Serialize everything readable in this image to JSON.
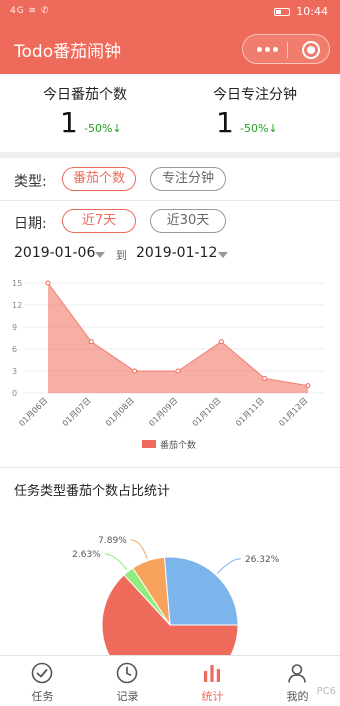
{
  "status": {
    "signal": "4G ≋ ✆",
    "time": "10:44"
  },
  "app": {
    "title": "Todo番茄闹钟",
    "accent": "#ee6b5b"
  },
  "summary": {
    "tomato_label": "今日番茄个数",
    "tomato_value": "1",
    "tomato_change": "-50%↓",
    "focus_label": "今日专注分钟",
    "focus_value": "1",
    "focus_change": "-50%↓"
  },
  "type_filter": {
    "label": "类型:",
    "options": [
      "番茄个数",
      "专注分钟"
    ],
    "selected": "番茄个数"
  },
  "date_filter": {
    "label": "日期:",
    "options": [
      "近7天",
      "近30天"
    ],
    "selected": "近7天"
  },
  "date_range": {
    "start": "2019-01-06",
    "to": "到",
    "end": "2019-01-12"
  },
  "chart_data": {
    "type": "area",
    "categories": [
      "01月06日",
      "01月07日",
      "01月08日",
      "01月09日",
      "01月10日",
      "01月11日",
      "01月12日"
    ],
    "series": [
      {
        "name": "番茄个数",
        "values": [
          15,
          7,
          3,
          3,
          7,
          2,
          1
        ]
      }
    ],
    "yticks": [
      "15",
      "12",
      "9",
      "6",
      "3",
      "0"
    ],
    "ylim": [
      0,
      15
    ],
    "color": "#ee6b5b",
    "legend": "bottom"
  },
  "pie_section": {
    "title": "任务类型番茄个数占比统计",
    "chart_data": {
      "type": "pie",
      "slices": [
        {
          "label": "26.32%",
          "value": 26.32,
          "color": "#7cb5ec"
        },
        {
          "label": "7.89%",
          "value": 7.89,
          "color": "#f7a35c"
        },
        {
          "label": "2.63%",
          "value": 2.63,
          "color": "#90ed7d"
        },
        {
          "label": "",
          "value": 63.16,
          "color": "#ee6b5b"
        }
      ]
    }
  },
  "tabs": [
    {
      "label": "任务",
      "icon": "check-circle-icon"
    },
    {
      "label": "记录",
      "icon": "clock-icon"
    },
    {
      "label": "统计",
      "icon": "bar-chart-icon",
      "active": true
    },
    {
      "label": "我的",
      "icon": "user-icon"
    }
  ],
  "watermark": "PC6"
}
